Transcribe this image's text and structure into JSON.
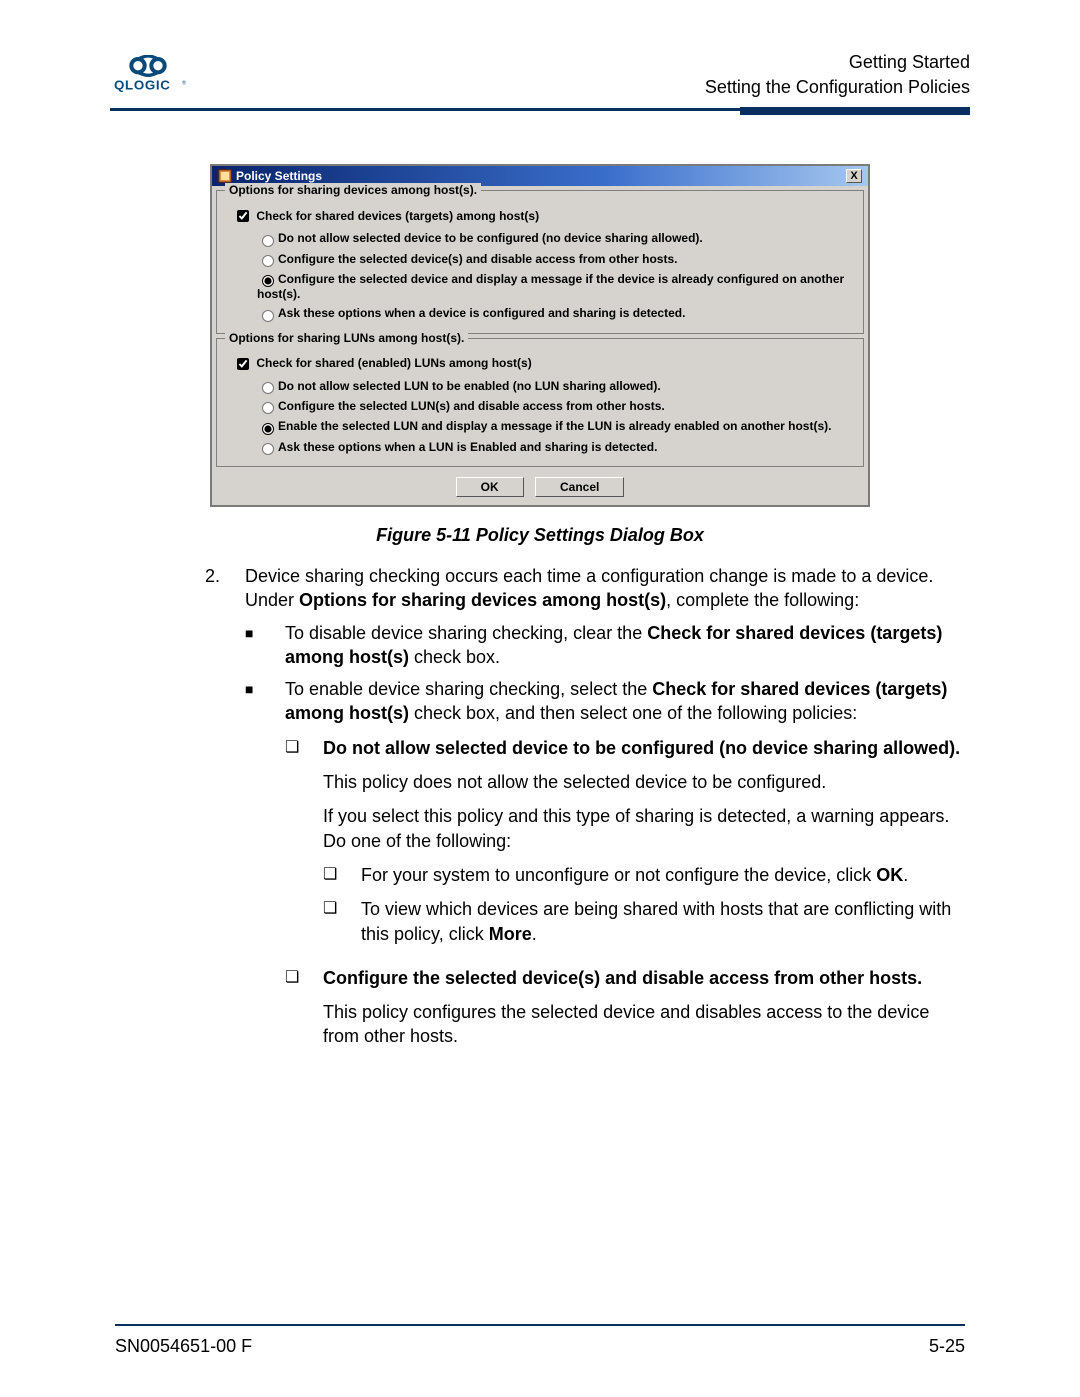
{
  "header": {
    "line1": "Getting Started",
    "line2": "Setting the Configuration Policies"
  },
  "dialog": {
    "title": "Policy Settings",
    "close_x": "X",
    "group1": {
      "legend": "Options for sharing devices among host(s).",
      "checkbox": "Check for shared devices (targets) among host(s)",
      "checkbox_checked": true,
      "radios": [
        "Do not allow selected device to be configured (no device sharing allowed).",
        "Configure the selected device(s) and disable access from other hosts.",
        "Configure the selected device and display a message if the device is already configured on another host(s).",
        "Ask these options when a device is configured and sharing is detected."
      ],
      "selected_index": 2
    },
    "group2": {
      "legend": "Options for sharing LUNs among host(s).",
      "checkbox": "Check for shared (enabled) LUNs among host(s)",
      "checkbox_checked": true,
      "radios": [
        "Do not allow selected LUN to be enabled (no LUN sharing allowed).",
        "Configure the selected LUN(s) and disable access from other hosts.",
        "Enable the selected LUN and display a message if the LUN is already enabled on another host(s).",
        "Ask these options when a LUN is Enabled and sharing is detected."
      ],
      "selected_index": 2
    },
    "ok": "OK",
    "cancel": "Cancel"
  },
  "caption": "Figure 5-11  Policy Settings Dialog Box",
  "body": {
    "step_num": "2.",
    "step_p1_a": "Device sharing checking occurs each time a configuration change is made to a device. Under ",
    "step_p1_b": "Options for sharing devices among host(s)",
    "step_p1_c": ", complete the following:",
    "b1_a": "To disable device sharing checking, clear the ",
    "b1_b": "Check for shared devices (targets) among host(s)",
    "b1_c": " check box.",
    "b2_a": "To enable device sharing checking, select the ",
    "b2_b": "Check for shared devices (targets) among host(s)",
    "b2_c": " check box, and then select one of the following policies:",
    "p1_title": "Do not allow selected device to be configured (no device sharing allowed).",
    "p1_desc": "This policy does not allow the selected device to be configured.",
    "p1_if": "If you select this policy and this type of sharing is detected, a warning appears. Do one of the following:",
    "p1_s1_a": "For your system to unconfigure or not configure the device, click ",
    "p1_s1_b": "OK",
    "p1_s1_c": ".",
    "p1_s2_a": "To view which devices are being shared with hosts that are conflicting with this policy, click ",
    "p1_s2_b": "More",
    "p1_s2_c": ".",
    "p2_title": "Configure the selected device(s) and disable access from other hosts.",
    "p2_desc": "This policy configures the selected device and disables access to the device from other hosts."
  },
  "footer": {
    "left": "SN0054651-00  F",
    "right": "5-25"
  }
}
